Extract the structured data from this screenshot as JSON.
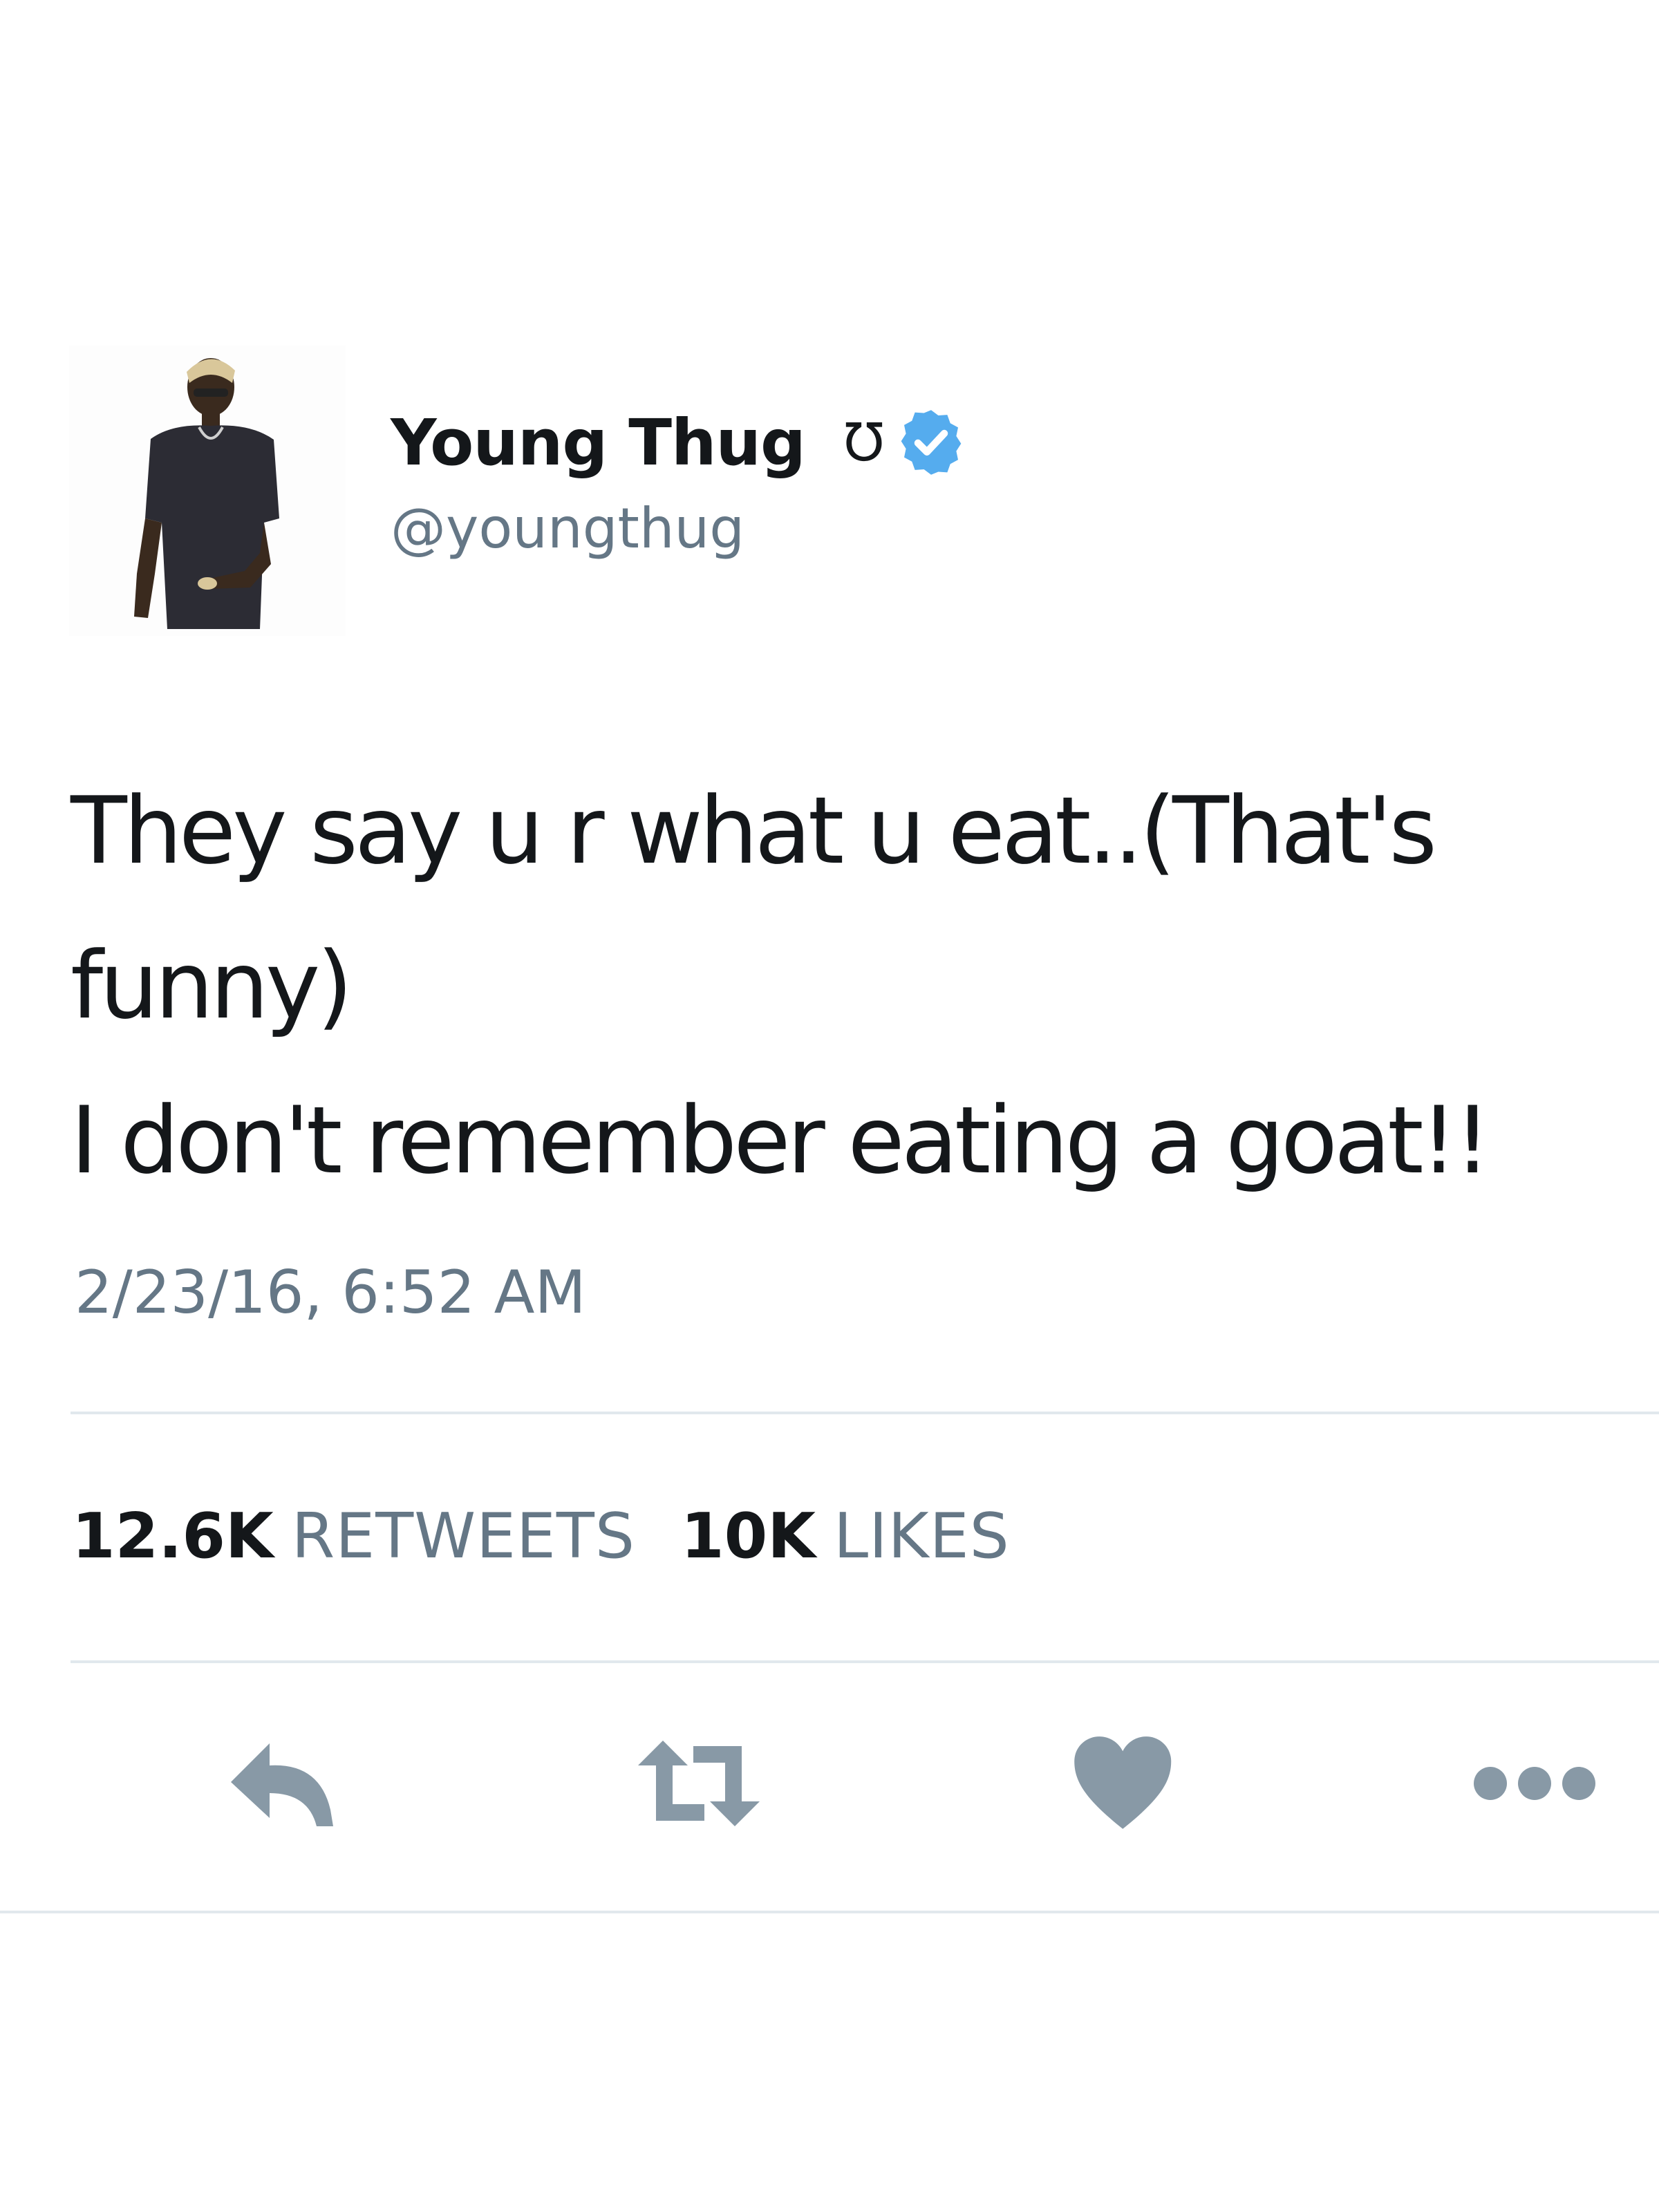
{
  "user": {
    "display_name": "Young Thug",
    "name_glyph": "℧",
    "handle": "@youngthug",
    "verified": true,
    "avatar_icon": "user-avatar-photo"
  },
  "tweet": {
    "lines": [
      "They say u r what u eat..(That's",
      "funny)",
      "I don't remember eating a goat!!"
    ],
    "timestamp": "2/23/16, 6:52 AM"
  },
  "stats": {
    "retweets_count": "12.6K",
    "retweets_label": "RETWEETS",
    "likes_count": "10K",
    "likes_label": "LIKES"
  },
  "actions": {
    "reply_icon": "reply-icon",
    "retweet_icon": "retweet-icon",
    "like_icon": "heart-icon",
    "more_icon": "more-icon"
  },
  "colors": {
    "text": "#14171a",
    "secondary": "#657786",
    "icon": "#8899a6",
    "verified": "#55acee",
    "divider": "#e1e8ed"
  }
}
